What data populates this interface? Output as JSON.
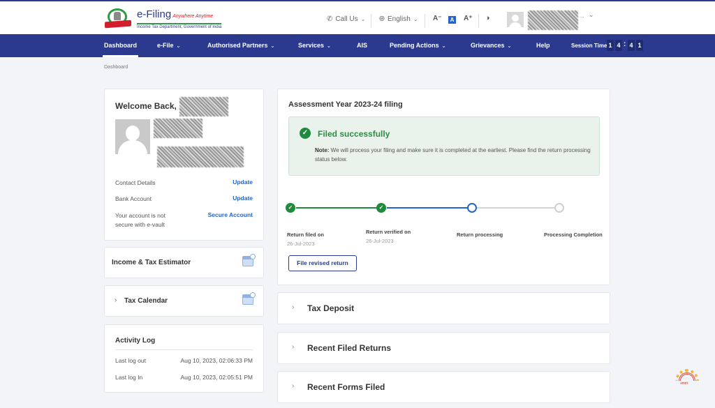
{
  "header": {
    "logo_title": "e-Filing",
    "logo_tagline": "Anywhere Anytime",
    "logo_subtitle": "Income Tax Department, Government of India",
    "call_us": "Call Us",
    "language": "English",
    "font_decrease": "A⁻",
    "font_default": "A",
    "font_increase": "A⁺",
    "contrast_icon": "◑",
    "user_name_redacted": "",
    "icons": {
      "phone": "phone-icon",
      "globe": "globe-icon",
      "contrast": "contrast-icon",
      "chevron": "chevron-down-icon"
    }
  },
  "nav": {
    "items": [
      {
        "label": "Dashboard",
        "dropdown": false,
        "active": true
      },
      {
        "label": "e-File",
        "dropdown": true
      },
      {
        "label": "Authorised Partners",
        "dropdown": true
      },
      {
        "label": "Services",
        "dropdown": true
      },
      {
        "label": "AIS",
        "dropdown": false
      },
      {
        "label": "Pending Actions",
        "dropdown": true
      },
      {
        "label": "Grievances",
        "dropdown": true
      },
      {
        "label": "Help",
        "dropdown": false
      }
    ],
    "session_label": "Session Time",
    "session_digits": [
      "1",
      "4",
      "4",
      "1"
    ],
    "session_separator": ":"
  },
  "breadcrumb": "Dashboard",
  "welcome": {
    "title": "Welcome Back,",
    "contact_label": "Contact Details",
    "contact_link": "Update",
    "bank_label": "Bank Account",
    "bank_link": "Update",
    "vault_label_line1": "Your account is not",
    "vault_label_line2": "secure with e-vault",
    "vault_link": "Secure Account"
  },
  "tools": {
    "estimator": "Income & Tax Estimator",
    "calendar": "Tax Calendar"
  },
  "activity": {
    "title": "Activity Log",
    "rows": [
      {
        "label": "Last log out",
        "value": "Aug 10, 2023, 02:06:33 PM"
      },
      {
        "label": "Last log In",
        "value": "Aug 10, 2023, 02:05:51 PM"
      }
    ]
  },
  "filing": {
    "title": "Assessment Year 2023-24 filing",
    "status_title": "Filed successfully",
    "note_label": "Note:",
    "note_text": " We will process your filing and make sure it is completed at the earliest. Please find the return processing status below.",
    "steps": [
      {
        "label": "Return filed on",
        "date": "26-Jul-2023",
        "state": "done"
      },
      {
        "label": "Return verified on",
        "date": "26-Jul-2023",
        "state": "done"
      },
      {
        "label": "Return processing",
        "date": "",
        "state": "current"
      },
      {
        "label": "Processing Completion",
        "date": "",
        "state": "pending"
      }
    ],
    "revise_button": "File revised return",
    "colors": {
      "done": "#1f8a3c",
      "current": "#2364c9",
      "pending": "#cfcfcf"
    }
  },
  "accordions": [
    {
      "title": "Tax Deposit"
    },
    {
      "title": "Recent Filed Returns"
    },
    {
      "title": "Recent Forms Filed"
    }
  ],
  "aadhaar_text": "आधार"
}
